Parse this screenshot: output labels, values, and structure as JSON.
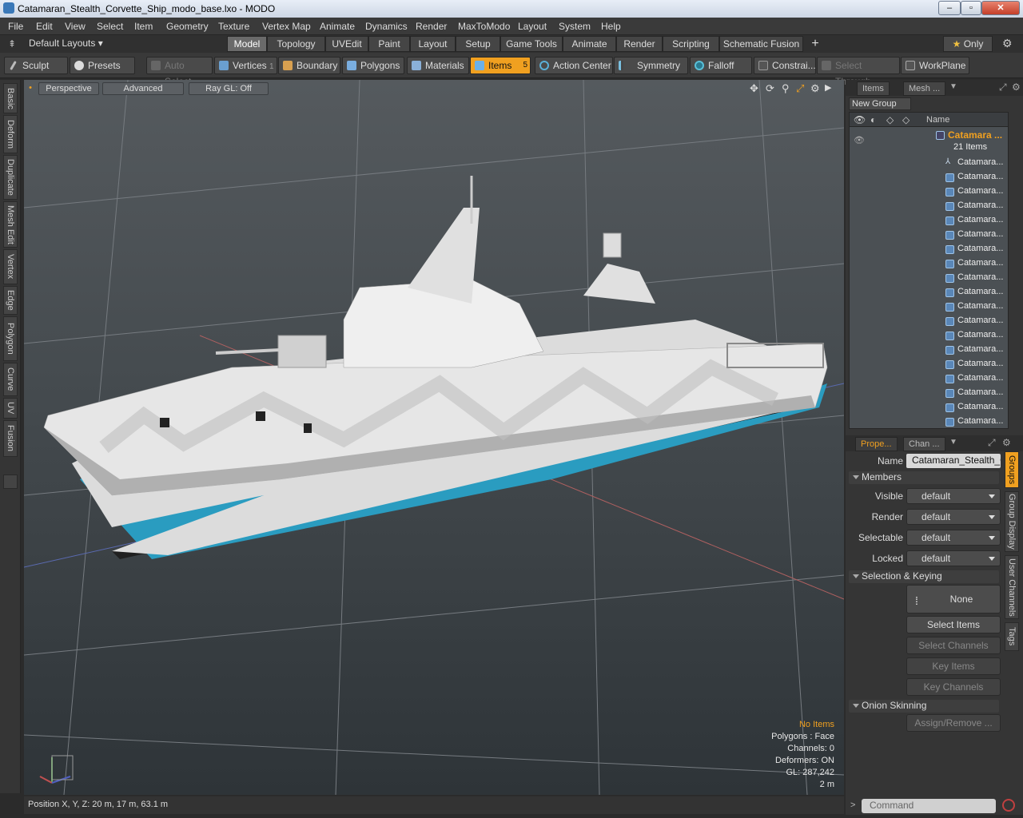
{
  "window": {
    "title": "Catamaran_Stealth_Corvette_Ship_modo_base.lxo - MODO"
  },
  "menu": [
    "File",
    "Edit",
    "View",
    "Select",
    "Item",
    "Geometry",
    "Texture",
    "Vertex Map",
    "Animate",
    "Dynamics",
    "Render",
    "MaxToModo",
    "Layout",
    "System",
    "Help"
  ],
  "layouts": {
    "label": "Default Layouts"
  },
  "tabs": [
    "Model",
    "Topology",
    "UVEdit",
    "Paint",
    "Layout",
    "Setup",
    "Game Tools",
    "Animate",
    "Render",
    "Scripting",
    "Schematic Fusion"
  ],
  "only_label": "Only",
  "toolbar": {
    "sculpt": "Sculpt",
    "presets": "Presets",
    "auto_select": "Auto Select",
    "vertices": "Vertices",
    "vertices_count": "1",
    "boundary": "Boundary",
    "polygons": "Polygons",
    "materials": "Materials",
    "items": "Items",
    "items_count": "5",
    "action_center": "Action Center",
    "symmetry": "Symmetry",
    "falloff": "Falloff",
    "constraints": "Constrai...",
    "select_through": "Select Through",
    "workplane": "WorkPlane"
  },
  "left_tabs": [
    "Basic",
    "Deform",
    "Duplicate",
    "Mesh Edit",
    "Vertex",
    "Edge",
    "Polygon",
    "Curve",
    "UV",
    "Fusion"
  ],
  "viewport": {
    "view": "Perspective",
    "shading": "Advanced",
    "raygl": "Ray GL: Off",
    "stats": [
      "No Items",
      "Polygons : Face",
      "Channels: 0",
      "Deformers: ON",
      "GL: 287,242",
      "2 m"
    ]
  },
  "status": {
    "position": "Position X, Y, Z:   20 m, 17 m, 63.1 m"
  },
  "items_panel": {
    "tabs": [
      "Items",
      "Mesh ..."
    ],
    "new_group": "New Group",
    "name_header": "Name",
    "group_name": "Catamara ...",
    "group_count": "21 Items",
    "children": [
      "Catamara...",
      "Catamara...",
      "Catamara...",
      "Catamara...",
      "Catamara...",
      "Catamara...",
      "Catamara...",
      "Catamara...",
      "Catamara...",
      "Catamara...",
      "Catamara...",
      "Catamara...",
      "Catamara...",
      "Catamara...",
      "Catamara...",
      "Catamara...",
      "Catamara...",
      "Catamara...",
      "Catamara..."
    ]
  },
  "properties": {
    "tabs": [
      "Prope...",
      "Chan ..."
    ],
    "name_label": "Name",
    "name_value": "Catamaran_Stealth_C",
    "members": "Members",
    "visible_label": "Visible",
    "visible": "default",
    "render_label": "Render",
    "render": "default",
    "selectable_label": "Selectable",
    "selectable": "default",
    "locked_label": "Locked",
    "locked": "default",
    "selection_keying": "Selection & Keying",
    "none": "None",
    "select_items": "Select Items",
    "select_channels": "Select Channels",
    "key_items": "Key Items",
    "key_channels": "Key Channels",
    "onion": "Onion Skinning",
    "assign": "Assign/Remove ..."
  },
  "right_vtabs": [
    "Groups",
    "Group Display",
    "User Channels",
    "Tags"
  ],
  "command": {
    "placeholder": "Command"
  },
  "colors": {
    "accent": "#f0a020",
    "hull_blue": "#2a9cc0",
    "hull_white": "#dcdcdc"
  }
}
